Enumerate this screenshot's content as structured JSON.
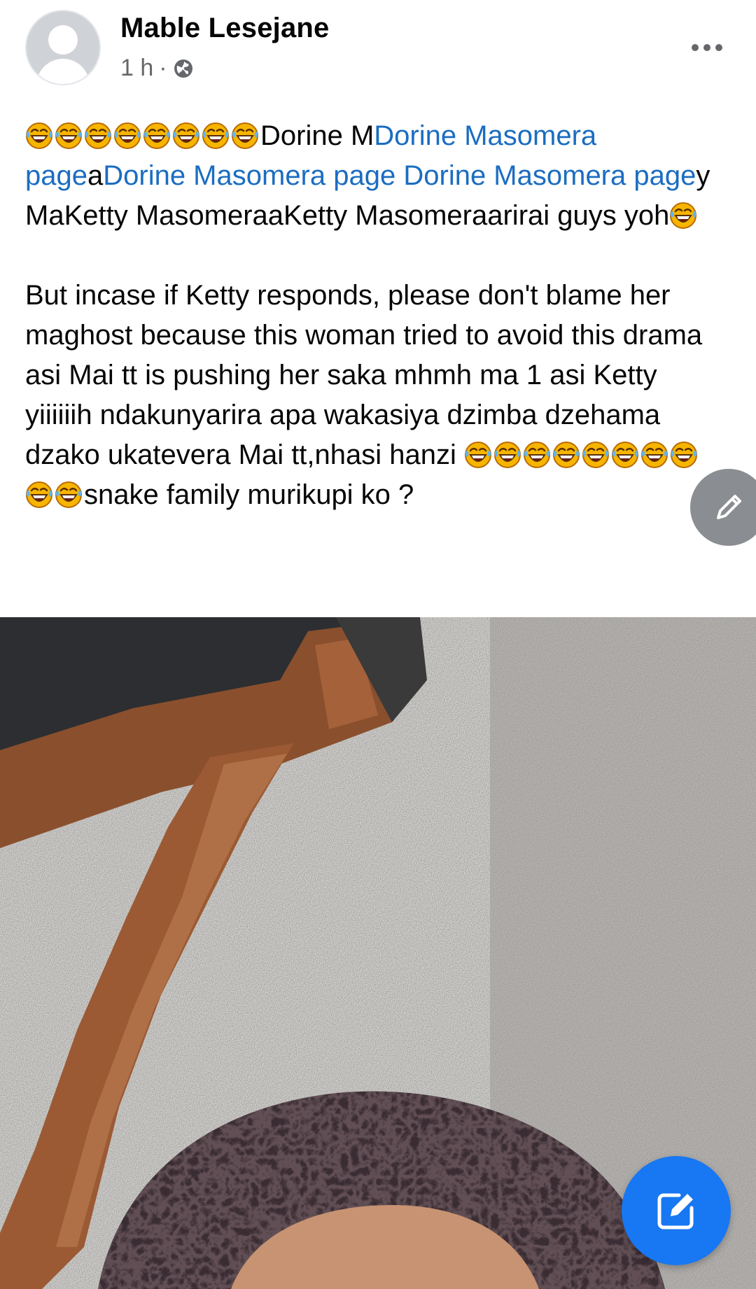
{
  "post": {
    "author": "Mable Lesejane",
    "time": "1 h",
    "separator": "·",
    "audience_icon": "globe-icon",
    "menu_icon": "more-options-icon",
    "paragraph1": [
      {
        "type": "emoji",
        "count": 8
      },
      {
        "type": "text",
        "text": "Dorine M"
      },
      {
        "type": "link",
        "text": "Dorine Masomera page"
      },
      {
        "type": "text",
        "text": "a"
      },
      {
        "type": "link",
        "text": "Dorine Masomera page"
      },
      {
        "type": "text",
        "text": " "
      },
      {
        "type": "link",
        "text": "Dorine Masomera page"
      },
      {
        "type": "text",
        "text": "y MaKetty MasomeraaKetty Masomeraarirai guys yoh"
      },
      {
        "type": "emoji",
        "count": 1
      }
    ],
    "paragraph2": [
      {
        "type": "text",
        "text": "But incase if Ketty responds, please don't blame her maghost because this woman tried to avoid this drama asi Mai tt is pushing her saka mhmh ma 1 asi Ketty yiiiiiih ndakunyarira apa wakasiya dzimba dzehama dzako ukatevera Mai tt,nhasi hanzi "
      },
      {
        "type": "emoji",
        "count": 10
      },
      {
        "type": "text",
        "text": "snake family murikupi ko ?"
      }
    ],
    "emoji_name": "face-with-tears-of-joy-icon",
    "link_color": "#1b6dc1"
  },
  "fab": {
    "edit_icon": "pencil-icon",
    "compose_icon": "compose-icon",
    "compose_color": "#1877f2"
  }
}
